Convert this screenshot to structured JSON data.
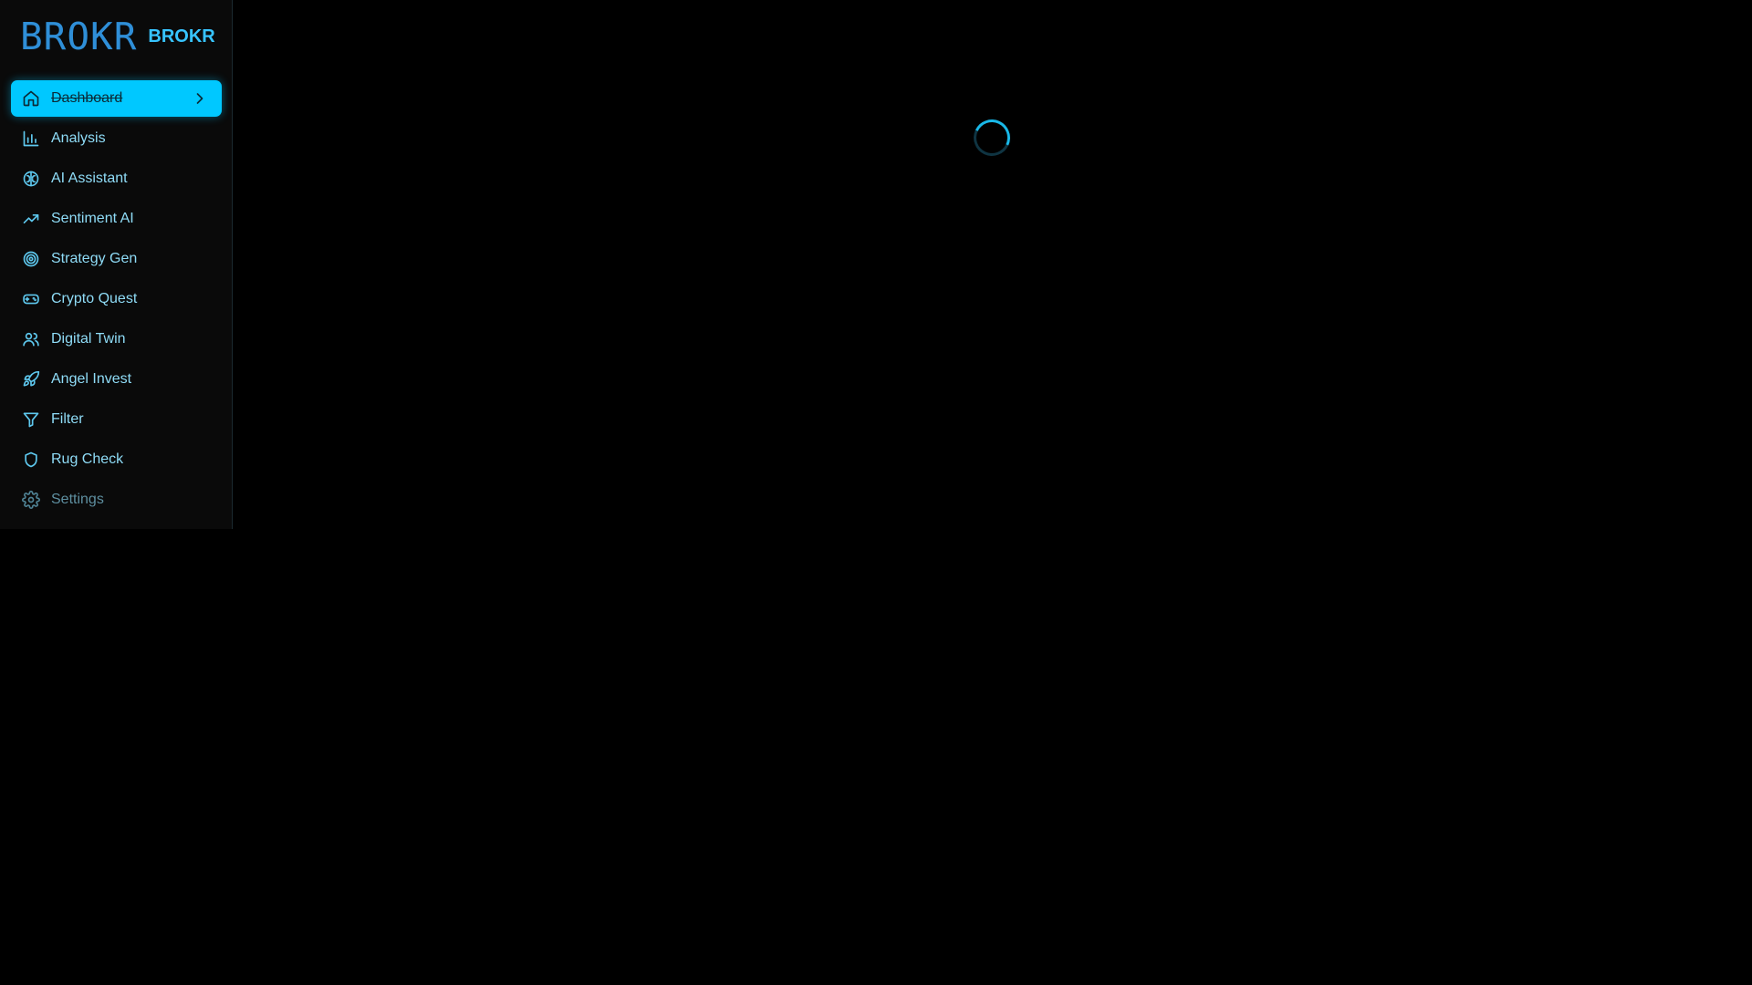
{
  "brand": {
    "logo_mark": "BROKR",
    "name": "BROKR",
    "accent_color": "#00c8ff"
  },
  "sidebar": {
    "items": [
      {
        "label": "Dashboard",
        "icon": "home-icon",
        "active": true
      },
      {
        "label": "Analysis",
        "icon": "bar-chart-icon"
      },
      {
        "label": "AI Assistant",
        "icon": "brain-icon"
      },
      {
        "label": "Sentiment AI",
        "icon": "trending-up-icon"
      },
      {
        "label": "Strategy Gen",
        "icon": "target-icon"
      },
      {
        "label": "Crypto Quest",
        "icon": "gamepad-icon"
      },
      {
        "label": "Digital Twin",
        "icon": "users-icon"
      },
      {
        "label": "Angel Invest",
        "icon": "rocket-icon"
      },
      {
        "label": "Filter",
        "icon": "filter-icon"
      },
      {
        "label": "Rug Check",
        "icon": "shield-icon"
      },
      {
        "label": "Settings",
        "icon": "gear-icon"
      }
    ]
  },
  "main": {
    "state": "loading"
  }
}
